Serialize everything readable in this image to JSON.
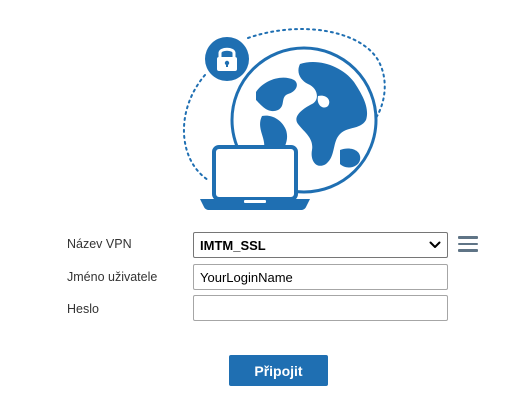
{
  "form": {
    "vpn_name_label": "Název VPN",
    "vpn_name_selected": "IMTM_SSL",
    "username_label": "Jméno uživatele",
    "username_value": "YourLoginName",
    "password_label": "Heslo",
    "password_value": ""
  },
  "connect_button_label": "Připojit",
  "icons": {
    "illustration": "vpn-globe-laptop-lock",
    "menu": "hamburger-menu-icon",
    "dropdown": "chevron-down-icon"
  },
  "colors": {
    "accent": "#1f6fb2",
    "menu_icon": "#5f7486"
  }
}
